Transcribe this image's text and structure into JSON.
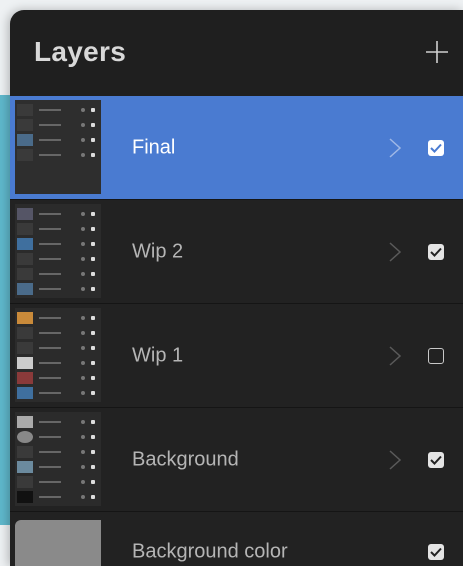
{
  "header": {
    "title": "Layers",
    "add_icon": "plus-icon"
  },
  "layers": [
    {
      "label": "Final",
      "selected": true,
      "visible": true,
      "has_chevron": true,
      "thumb_rows": 4
    },
    {
      "label": "Wip 2",
      "selected": false,
      "visible": true,
      "has_chevron": true,
      "thumb_rows": 6
    },
    {
      "label": "Wip 1",
      "selected": false,
      "visible": false,
      "has_chevron": true,
      "thumb_rows": 6
    },
    {
      "label": "Background",
      "selected": false,
      "visible": true,
      "has_chevron": true,
      "thumb_rows": 6
    }
  ],
  "background_color": {
    "label": "Background color",
    "visible": true,
    "swatch": "#8a8a8a"
  },
  "colors": {
    "selected_row": "#4a7bd1",
    "panel": "#1f1f1f",
    "accent_side": "#5fb8cc"
  }
}
